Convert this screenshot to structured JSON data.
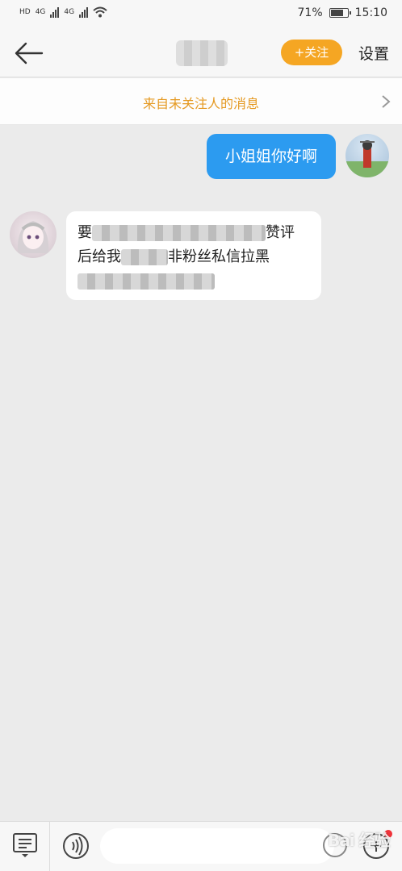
{
  "status_bar": {
    "left_labels": [
      "HD",
      "4G",
      "4G"
    ],
    "battery_level": 0.71,
    "battery_text": "71%",
    "time": "15:10",
    "icons": [
      "signal-icon",
      "wifi-icon",
      "battery-icon"
    ]
  },
  "header": {
    "back_icon": "back-arrow-icon",
    "follow_label": "+关注",
    "settings_label": "设置",
    "accent_color": "#f5a623"
  },
  "banner": {
    "text": "来自未关注人的消息",
    "chevron_icon": "chevron-right-icon",
    "text_color": "#e59a23"
  },
  "messages": [
    {
      "side": "right",
      "text": "小姐姐你好啊",
      "bubble_color": "#2c9bf0"
    },
    {
      "side": "left",
      "line1_start": "要",
      "line1_end": "赞评",
      "line2_start": "后给我",
      "line2_end": "非粉丝私信拉黑"
    }
  ],
  "bottom_bar": {
    "icons": [
      "menu-icon",
      "voice-icon",
      "emoji-icon",
      "plus-icon"
    ],
    "input_placeholder": "",
    "watermark": "Bai 经验"
  }
}
